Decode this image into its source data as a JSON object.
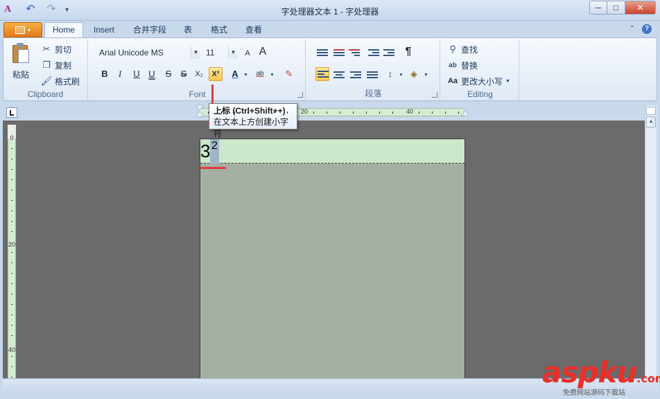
{
  "window": {
    "title": "字处理器文本 1 - 字处理器",
    "min": "─",
    "max": "□",
    "close": "✕"
  },
  "qat": {
    "app_glyph": "A",
    "undo": "↶",
    "redo": "↷",
    "more": "▾"
  },
  "tabs": [
    {
      "label": "Home"
    },
    {
      "label": "Insert"
    },
    {
      "label": "合并字段"
    },
    {
      "label": "表"
    },
    {
      "label": "格式"
    },
    {
      "label": "查看"
    }
  ],
  "help": {
    "collapse": "⌃",
    "question": "?"
  },
  "clipboard": {
    "label": "Clipboard",
    "paste": "粘贴",
    "cut": "剪切",
    "copy": "复制",
    "format_painter": "格式刷"
  },
  "font": {
    "label": "Font",
    "name": "Arial Unicode MS",
    "size": "11",
    "grow": "A",
    "shrink": "A",
    "bold": "B",
    "italic": "I",
    "underline": "U",
    "double_underline": "U",
    "strike": "S",
    "double_strike": "S",
    "subscript": "X₂",
    "superscript": "X²",
    "color": "A",
    "highlight": "ab"
  },
  "paragraph": {
    "label": "段落",
    "show_marks": "¶"
  },
  "editing": {
    "label": "Editing",
    "find": "查找",
    "replace": "替换",
    "change_case": "更改大小写",
    "change_case_icon": "Aa"
  },
  "ruler": {
    "h20": "20",
    "h40": "40",
    "v0": "0",
    "v20": "20",
    "v40": "40"
  },
  "tooltip": {
    "title": "上标 (Ctrl+Shift++)",
    "description": "在文本上方创建小字符"
  },
  "document": {
    "base": "3",
    "superscript": "2"
  },
  "watermark": {
    "brand": "aspku",
    "tld": ".com",
    "tagline": "免费网站源码下载站"
  }
}
